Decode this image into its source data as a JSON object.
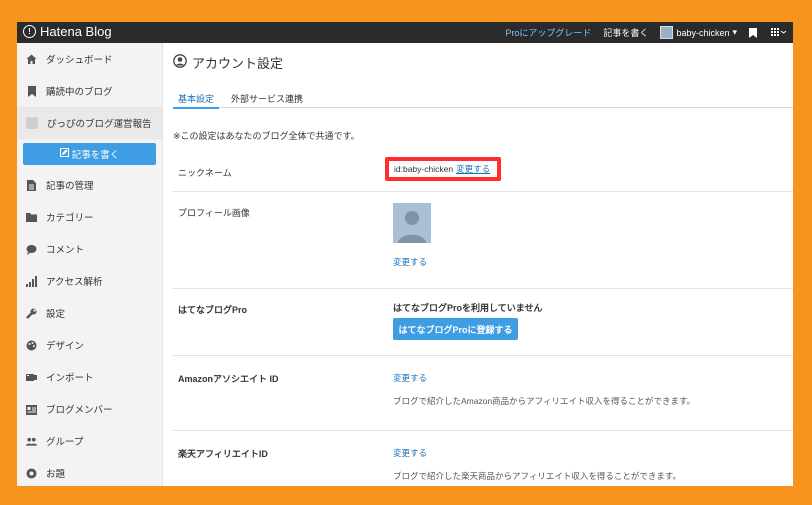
{
  "topbar": {
    "logo": "Hatena Blog",
    "upgrade": "Proにアップグレード",
    "write": "記事を書く",
    "username": "baby-chicken"
  },
  "sidebar": {
    "items": [
      {
        "label": "ダッシュボード",
        "icon": "home-icon"
      },
      {
        "label": "購読中のブログ",
        "icon": "bookmark-icon"
      }
    ],
    "blog_name": "ぴっぴのブログ運営報告",
    "write_button": "記事を書く",
    "menu": [
      {
        "label": "記事の管理",
        "icon": "document-icon"
      },
      {
        "label": "カテゴリー",
        "icon": "folder-icon"
      },
      {
        "label": "コメント",
        "icon": "comment-icon"
      },
      {
        "label": "アクセス解析",
        "icon": "bar-chart-icon"
      },
      {
        "label": "設定",
        "icon": "wrench-icon"
      },
      {
        "label": "デザイン",
        "icon": "palette-icon"
      },
      {
        "label": "インポート",
        "icon": "import-icon"
      },
      {
        "label": "ブログメンバー",
        "icon": "members-icon"
      },
      {
        "label": "グループ",
        "icon": "group-icon"
      },
      {
        "label": "お題",
        "icon": "topic-icon"
      }
    ]
  },
  "main": {
    "title": "アカウント設定",
    "tabs": [
      {
        "label": "基本設定"
      },
      {
        "label": "外部サービス連携"
      }
    ],
    "note": "※この設定はあなたのブログ全体で共通です。",
    "nickname": {
      "label": "ニックネーム",
      "id": "id:baby-chicken",
      "change": "変更する"
    },
    "profile": {
      "label": "プロフィール画像",
      "change": "変更する"
    },
    "pro": {
      "label": "はてなブログPro",
      "status": "はてなブログProを利用していません",
      "button": "はてなブログProに登録する"
    },
    "amazon": {
      "label": "Amazonアソシエイト ID",
      "change": "変更する",
      "description": "ブログで紹介したAmazon商品からアフィリエイト収入を得ることができます。"
    },
    "rakuten": {
      "label": "楽天アフィリエイトID",
      "change": "変更する",
      "description": "ブログで紹介した楽天商品からアフィリエイト収入を得ることができます。"
    }
  }
}
